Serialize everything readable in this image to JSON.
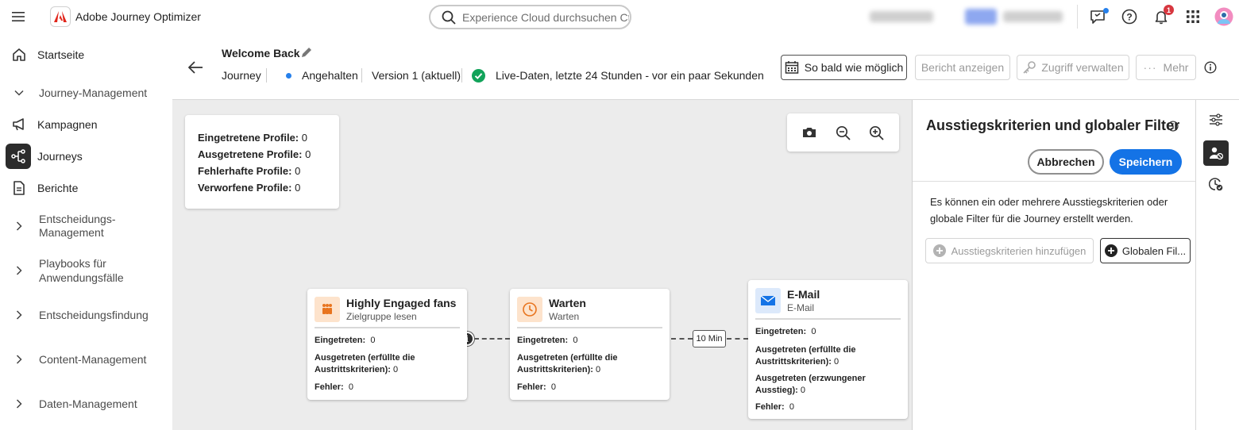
{
  "app": {
    "title": "Adobe Journey Optimizer",
    "search_placeholder": "Experience Cloud durchsuchen Ctr...",
    "notification_count": "1"
  },
  "sidebar": {
    "items": [
      {
        "label": "Startseite",
        "icon": "home-icon"
      },
      {
        "label": "Journey-Management",
        "icon": "chevron-down-icon"
      },
      {
        "label": "Kampagnen",
        "icon": "megaphone-icon"
      },
      {
        "label": "Journeys",
        "icon": "journey-icon"
      },
      {
        "label": "Berichte",
        "icon": "document-icon"
      },
      {
        "label_line1": "Entscheidungs-",
        "label_line2": "Management",
        "icon": "chevron-right-icon"
      },
      {
        "label_line1": "Playbooks für",
        "label_line2": "Anwendungsfälle",
        "icon": "chevron-right-icon"
      },
      {
        "label": "Entscheidungsfindung",
        "icon": "chevron-right-icon"
      },
      {
        "label": "Content-Management",
        "icon": "chevron-right-icon"
      },
      {
        "label": "Daten-Management",
        "icon": "chevron-right-icon"
      }
    ]
  },
  "journey": {
    "title": "Welcome Back",
    "type": "Journey",
    "status": "Angehalten",
    "version": "Version 1 (aktuell)",
    "live_data": "Live-Daten, letzte 24 Stunden - vor ein paar Sekunden"
  },
  "toolbar": {
    "schedule": "So bald wie möglich",
    "report": "Bericht anzeigen",
    "access": "Zugriff verwalten",
    "more": "Mehr"
  },
  "stats": {
    "entered_label": "Eingetretene Profile:",
    "entered_value": "0",
    "exited_label": "Ausgetretene Profile:",
    "exited_value": "0",
    "error_label": "Fehlerhafte Profile:",
    "error_value": "0",
    "discarded_label": "Verworfene Profile:",
    "discarded_value": "0"
  },
  "nodes": {
    "audience": {
      "title": "Highly Engaged fans",
      "subtitle": "Zielgruppe lesen",
      "entered_label": "Eingetreten:",
      "entered_value": "0",
      "exited_label_1": "Ausgetreten (erfüllte die",
      "exited_label_2": "Austrittskriterien):",
      "exited_value": "0",
      "error_label": "Fehler:",
      "error_value": "0"
    },
    "wait": {
      "title": "Warten",
      "subtitle": "Warten",
      "entered_label": "Eingetreten:",
      "entered_value": "0",
      "exited_label_1": "Ausgetreten (erfüllte die",
      "exited_label_2": "Austrittskriterien):",
      "exited_value": "0",
      "error_label": "Fehler:",
      "error_value": "0",
      "duration": "10 Min"
    },
    "email": {
      "title": "E-Mail",
      "subtitle": "E-Mail",
      "entered_label": "Eingetreten:",
      "entered_value": "0",
      "exited_label_1": "Ausgetreten (erfüllte die",
      "exited_label_2": "Austrittskriterien):",
      "exited_value": "0",
      "forced_label_1": "Ausgetreten (erzwungener",
      "forced_label_2": "Ausstieg):",
      "forced_value": "0",
      "error_label": "Fehler:",
      "error_value": "0"
    }
  },
  "panel": {
    "title": "Ausstiegskriterien und globaler Filter",
    "cancel": "Abbrechen",
    "save": "Speichern",
    "description": "Es können ein oder mehrere Ausstiegskriterien oder globale Filter für die Journey erstellt werden.",
    "add_exit": "Ausstiegskriterien hinzufügen",
    "global_filter": "Globalen Fil..."
  },
  "colors": {
    "accent": "#1473e6",
    "status_blue": "#2680eb",
    "live_green": "#12a35a",
    "audience_icon_bg": "#fde3cc",
    "email_icon_bg": "#dce9fb"
  }
}
